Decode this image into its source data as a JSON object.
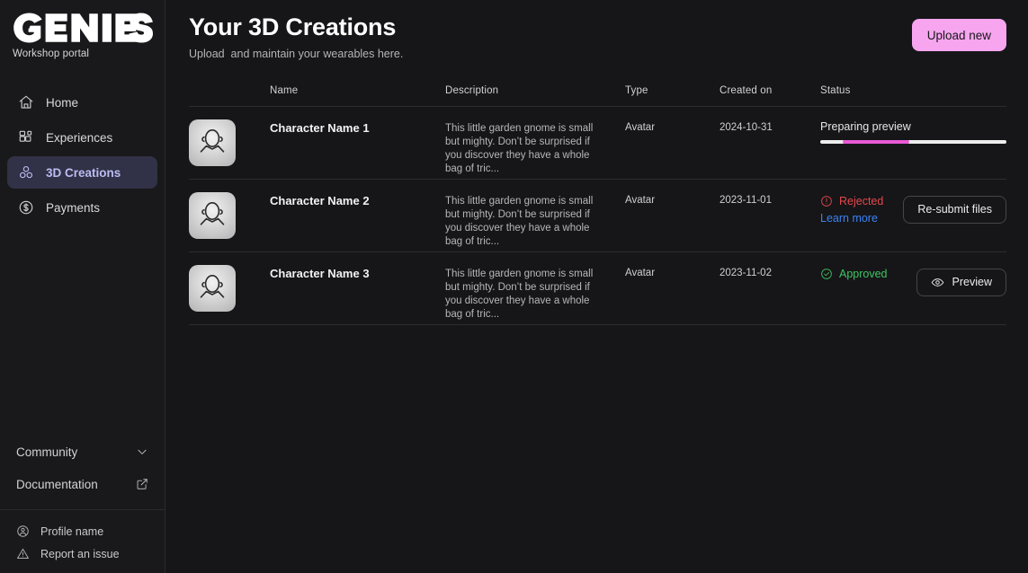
{
  "sidebar": {
    "brand": {
      "logo_text": "GENIES",
      "subtitle": "Workshop portal"
    },
    "items": [
      {
        "label": "Home",
        "icon": "home-icon",
        "active": false
      },
      {
        "label": "Experiences",
        "icon": "grid-blocks-icon",
        "active": false
      },
      {
        "label": "3D Creations",
        "icon": "cubes-cluster-icon",
        "active": true
      },
      {
        "label": "Payments",
        "icon": "dollar-circle-icon",
        "active": false
      }
    ],
    "lower": [
      {
        "label": "Community",
        "icon": "chevron-down-icon"
      },
      {
        "label": "Documentation",
        "icon": "external-link-icon"
      }
    ],
    "footer": [
      {
        "label": "Profile name",
        "icon": "user-circle-icon"
      },
      {
        "label": "Report an issue",
        "icon": "warning-triangle-icon"
      }
    ]
  },
  "header": {
    "title": "Your 3D Creations",
    "subtitle": "Upload  and maintain your wearables here.",
    "upload_label": "Upload new"
  },
  "table": {
    "columns": [
      "",
      "Name",
      "Description",
      "Type",
      "Created on",
      "Status"
    ],
    "rows": [
      {
        "thumbnail": "avatar-placeholder",
        "name": "Character Name 1",
        "description": "This little garden gnome is small but mighty. Don’t be surprised if you discover they have a whole bag of tric...",
        "type": "Avatar",
        "created_on": "2024-10-31",
        "status": {
          "kind": "progress",
          "label": "Preparing preview",
          "progress_start_pct": 12,
          "progress_width_pct": 36
        },
        "action": null
      },
      {
        "thumbnail": "avatar-placeholder",
        "name": "Character Name 2",
        "description": "This little garden gnome is small but mighty. Don’t be surprised if you discover they have a whole bag of tric...",
        "type": "Avatar",
        "created_on": "2023-11-01",
        "status": {
          "kind": "rejected",
          "label": "Rejected",
          "icon": "alert-circle-icon",
          "link_label": "Learn more"
        },
        "action": {
          "label": "Re-submit files",
          "icon": null
        }
      },
      {
        "thumbnail": "avatar-placeholder",
        "name": "Character Name 3",
        "description": "This little garden gnome is small but mighty. Don’t be surprised if you discover they have a whole bag of tric...",
        "type": "Avatar",
        "created_on": "2023-11-02",
        "status": {
          "kind": "approved",
          "label": "Approved",
          "icon": "check-circle-icon"
        },
        "action": {
          "label": "Preview",
          "icon": "eye-icon"
        }
      }
    ]
  },
  "colors": {
    "accent_pink": "#f7a5ef",
    "progress_magenta": "#e95ad6",
    "active_nav_bg": "#313147",
    "active_nav_text": "#bcbcf2",
    "rejected_red": "#e5484d",
    "approved_green": "#3fc463",
    "link_blue": "#3b82f6",
    "sidebar_bg": "#19191b",
    "main_bg": "#161618"
  }
}
